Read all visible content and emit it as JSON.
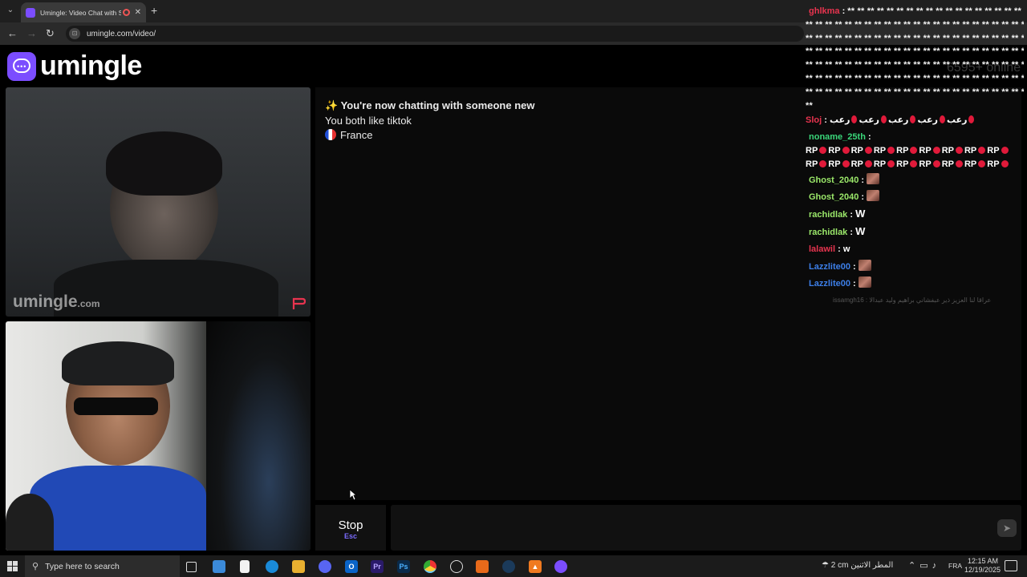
{
  "browser": {
    "tab_title": "Umingle: Video Chat with S",
    "tab_close": "✕",
    "new_tab": "+",
    "url": "umingle.com/video/",
    "url_icon": "⊡",
    "nav": {
      "back": "←",
      "forward": "→",
      "reload": "↻"
    }
  },
  "site": {
    "logo_text": "umingle",
    "online_text": "6595+ online"
  },
  "video": {
    "watermark_brand": "umingle",
    "watermark_tld": ".com"
  },
  "chat": {
    "lines": {
      "sparkle": "✨",
      "new_chat": "You're now chatting with someone new",
      "interest": "You both like tiktok",
      "country": "France"
    },
    "stop_label": "Stop",
    "stop_key": "Esc",
    "send_icon": "➤"
  },
  "overlay": {
    "rows": [
      {
        "name": "ghlkma",
        "color": "#e8344f",
        "text": "** ** ** ** ** ** ** ** ** ** ** ** ** ** ** ** ** **"
      },
      {
        "name": "",
        "color": "#ffffff",
        "text": "** ** ** ** ** ** ** ** ** ** ** ** ** ** ** ** ** ** ** ** ** ** **"
      },
      {
        "name": "",
        "color": "#ffffff",
        "text": "** ** ** ** ** ** ** ** ** ** ** ** ** ** ** ** ** ** ** ** ** ** **"
      },
      {
        "name": "",
        "color": "#ffffff",
        "text": "** ** ** ** ** ** ** ** ** ** ** ** ** ** ** ** ** ** ** ** ** ** **"
      },
      {
        "name": "",
        "color": "#ffffff",
        "text": "** ** ** ** ** ** ** ** ** ** ** ** ** ** ** ** ** ** ** ** ** ** **"
      },
      {
        "name": "",
        "color": "#ffffff",
        "text": "** ** ** ** ** ** ** ** ** ** ** ** ** ** ** ** ** ** ** ** ** ** **"
      },
      {
        "name": "",
        "color": "#ffffff",
        "text": "** ** ** ** ** ** ** ** ** ** ** ** ** ** ** ** ** ** ** ** ** ** **"
      },
      {
        "name": "",
        "color": "#ffffff",
        "text": "**"
      }
    ],
    "sloj": {
      "name": "Sloj",
      "color": "#e8344f",
      "word": "رعب"
    },
    "noname": {
      "name": "noname_25th",
      "color": "#3ad77a",
      "rp": "RP"
    },
    "emote_rows": [
      {
        "name": "Ghost_2040",
        "color": "#9be86a",
        "type": "emote",
        "text": ""
      },
      {
        "name": "Ghost_2040",
        "color": "#9be86a",
        "type": "emote",
        "text": ""
      },
      {
        "name": "rachidlak",
        "color": "#9be86a",
        "type": "w",
        "text": "W"
      },
      {
        "name": "rachidlak",
        "color": "#9be86a",
        "type": "w",
        "text": "W"
      },
      {
        "name": "lalawil",
        "color": "#e8344f",
        "type": "text",
        "text": "w"
      },
      {
        "name": "Lazzlite00",
        "color": "#3d7fe8",
        "type": "emote",
        "text": ""
      },
      {
        "name": "Lazzlite00",
        "color": "#3d7fe8",
        "type": "emote",
        "text": ""
      }
    ],
    "faint_row": "issamgh16 : عراقا لنا العزيز ذير عبفشاني براهيم وليد عبدالا"
  },
  "taskbar": {
    "search_placeholder": "Type here to search",
    "weather": "2 cm  المطر الاثنين",
    "lang": "FRA",
    "time": "12:15 AM",
    "date": "12/19/2025",
    "colors": {
      "premiere": "#2a1a6a",
      "photoshop": "#0a2a4a",
      "discord": "#5865f2",
      "outlook": "#0a64c8",
      "edge": "#1a8ad8",
      "files": "#e8b030"
    }
  }
}
